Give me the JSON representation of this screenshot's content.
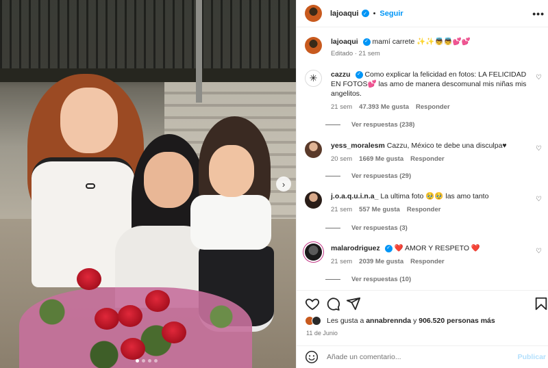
{
  "header": {
    "username": "lajoaqui",
    "separator": "•",
    "follow_label": "Seguir",
    "more_label": "•••"
  },
  "caption": {
    "username": "lajoaqui",
    "text": "mamí carrete ✨✨👼👼💕💕",
    "meta": "Editado · 21 sem"
  },
  "comments": [
    {
      "username": "cazzu",
      "verified": true,
      "text": "Como explicar la felicidad en fotos: LA FELICIDAD EN FOTOS💕 las amo de manera descomunal mis niñas mis angelitos.",
      "time": "21 sem",
      "likes": "47.393 Me gusta",
      "reply": "Responder",
      "view_replies": "Ver respuestas (238)"
    },
    {
      "username": "yess_moralesm",
      "verified": false,
      "text": "Cazzu, México te debe una disculpa♥",
      "time": "20 sem",
      "likes": "1669 Me gusta",
      "reply": "Responder",
      "view_replies": "Ver respuestas (29)"
    },
    {
      "username": "j.o.a.q.u.i.n.a_",
      "verified": false,
      "text": "La ultima foto 🥹🥹 las amo tanto",
      "time": "21 sem",
      "likes": "557 Me gusta",
      "reply": "Responder",
      "view_replies": "Ver respuestas (3)"
    },
    {
      "username": "malarodriguez",
      "verified": true,
      "text": "❤️ AMOR Y RESPETO ❤️",
      "time": "21 sem",
      "likes": "2039 Me gusta",
      "reply": "Responder",
      "view_replies": "Ver respuestas (10)"
    }
  ],
  "likes": {
    "prefix": "Les gusta a ",
    "user": "annabrennda",
    "middle": " y ",
    "count": "906.520 personas más"
  },
  "date": "11 de Junio",
  "add_comment": {
    "placeholder": "Añade un comentario...",
    "publish_label": "Publicar"
  },
  "colors": {
    "accent": "#0095f6",
    "muted": "#737373",
    "publish_disabled": "#b2dffc"
  },
  "carousel": {
    "total": 4,
    "current": 1
  },
  "icons": [
    "heart-icon",
    "comment-icon",
    "share-icon",
    "bookmark-icon",
    "emoji-icon",
    "chevron-right-icon",
    "verified-icon",
    "more-icon"
  ]
}
